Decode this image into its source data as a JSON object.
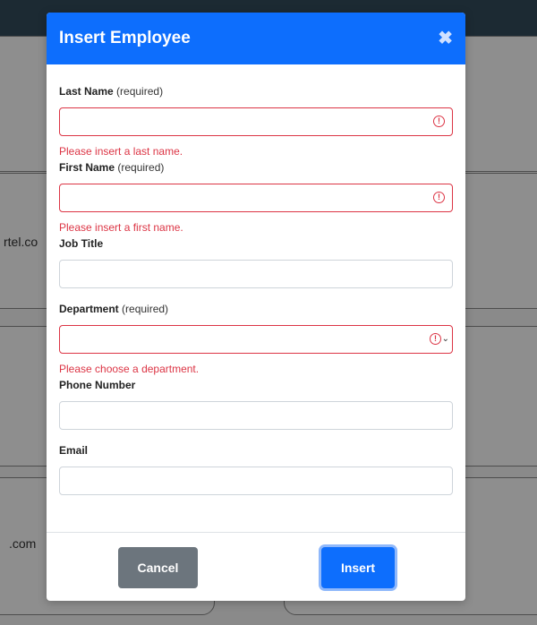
{
  "background": {
    "texts": [
      "rtel.co",
      ".com"
    ]
  },
  "modal": {
    "title": "Insert Employee",
    "close_label": "✖",
    "fields": {
      "last_name": {
        "label": "Last Name",
        "required_note": "(required)",
        "value": "",
        "error": "Please insert a last name."
      },
      "first_name": {
        "label": "First Name",
        "required_note": "(required)",
        "value": "",
        "error": "Please insert a first name."
      },
      "job_title": {
        "label": "Job Title",
        "value": ""
      },
      "department": {
        "label": "Department",
        "required_note": "(required)",
        "selected": "",
        "error": "Please choose a department."
      },
      "phone": {
        "label": "Phone Number",
        "value": ""
      },
      "email": {
        "label": "Email",
        "value": ""
      }
    },
    "error_icon_glyph": "!",
    "caret_glyph": "⌄",
    "footer": {
      "cancel_label": "Cancel",
      "insert_label": "Insert"
    }
  },
  "colors": {
    "primary": "#0d6efd",
    "danger": "#dc3545",
    "secondary": "#6c757d"
  }
}
